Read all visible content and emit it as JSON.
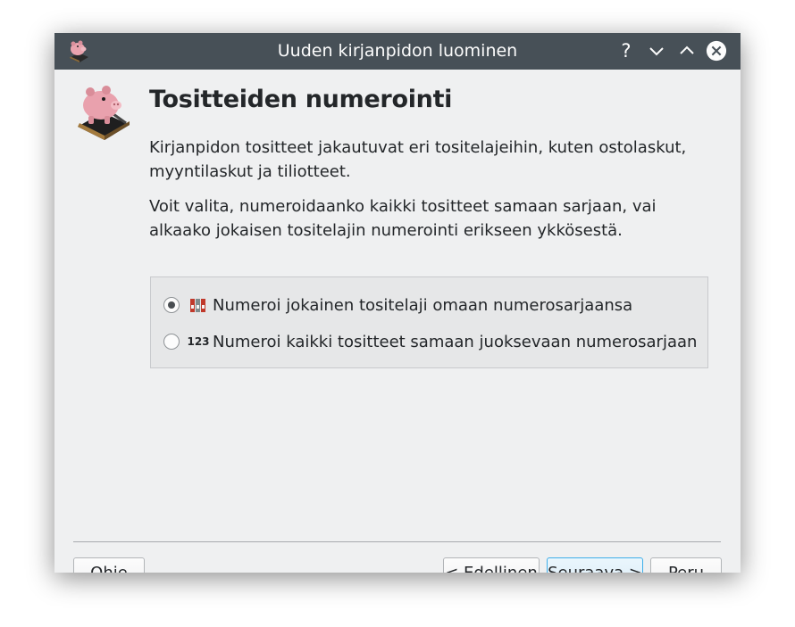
{
  "window": {
    "title": "Uuden kirjanpidon luominen",
    "help_glyph": "?",
    "colors": {
      "titlebar": "#475057",
      "body": "#eff0f1",
      "accent": "#3daee9"
    }
  },
  "page": {
    "heading": "Tositteiden numerointi",
    "paragraph1": "Kirjanpidon tositteet jakautuvat eri tositelajeihin, kuten ostolaskut, myyntilaskut ja tiliotteet.",
    "paragraph2": "Voit valita, numeroidaanko kaikki tositteet samaan sarjaan, vai alkaako jokaisen tositelajin numerointi erikseen ykkösestä."
  },
  "options": [
    {
      "label": "Numeroi jokainen tositelaji omaan numerosarjaansa",
      "icon": "binders-icon",
      "selected": true
    },
    {
      "label": "Numeroi kaikki tositteet samaan juoksevaan numerosarjaan",
      "icon_text": "123",
      "icon": "numbers-icon",
      "selected": false
    }
  ],
  "buttons": {
    "help": {
      "pre": "O",
      "mnemonic": "h",
      "post": "je"
    },
    "previous": {
      "pre": "< E",
      "mnemonic": "d",
      "post": "ellinen"
    },
    "next": {
      "pre": "",
      "mnemonic": "S",
      "post": "euraava >"
    },
    "cancel": "Peru"
  }
}
